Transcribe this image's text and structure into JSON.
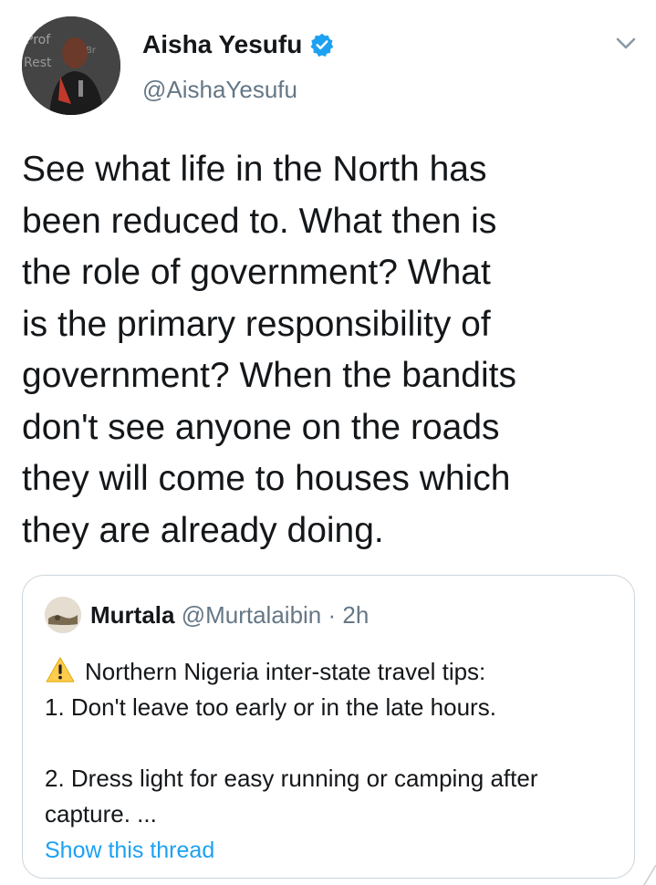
{
  "author": {
    "display_name": "Aisha Yesufu",
    "handle": "@AishaYesufu",
    "verified": true,
    "avatar_icon": "profile-photo"
  },
  "tweet": {
    "lines": [
      "See what life in the North has",
      "been reduced to. What then is",
      "the role of government? What",
      "is the primary responsibility of",
      "government? When the bandits",
      "don't see anyone on the roads",
      "they will come to houses which",
      "they are already doing."
    ]
  },
  "quoted": {
    "display_name": "Murtala",
    "handle": "@Murtalaibin",
    "separator": "·",
    "time": "2h",
    "body": {
      "line1": "Northern Nigeria inter-state travel tips:",
      "line2": "1.  Don't leave too early or in the late hours.",
      "line3": "2. Dress light for easy running or camping after",
      "line4": "capture. ..."
    },
    "show_thread_label": "Show this thread"
  },
  "colors": {
    "text": "#14171a",
    "secondary": "#657786",
    "link": "#1da1f2",
    "border": "#ccd6dd",
    "verified_badge": "#1da1f2",
    "warning": "#ffcc4d"
  }
}
